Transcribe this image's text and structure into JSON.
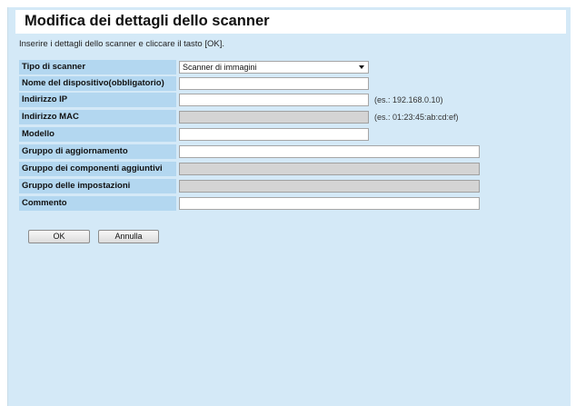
{
  "header": {
    "title": "Modifica dei dettagli dello scanner"
  },
  "instruction": "Inserire i dettagli dello scanner e cliccare il tasto [OK].",
  "form": {
    "scanner_type": {
      "label": "Tipo di scanner",
      "selected": "Scanner di immagini"
    },
    "device_name": {
      "label": "Nome del dispositivo(obbligatorio)",
      "value": ""
    },
    "ip_address": {
      "label": "Indirizzo IP",
      "value": "",
      "hint": "(es.: 192.168.0.10)"
    },
    "mac_address": {
      "label": "Indirizzo MAC",
      "value": "",
      "hint": "(es.: 01:23:45:ab:cd:ef)"
    },
    "model": {
      "label": "Modello",
      "value": ""
    },
    "update_group": {
      "label": "Gruppo di aggiornamento",
      "value": ""
    },
    "addon_group": {
      "label": "Gruppo dei componenti aggiuntivi",
      "value": ""
    },
    "settings_group": {
      "label": "Gruppo delle impostazioni",
      "value": ""
    },
    "comment": {
      "label": "Commento",
      "value": ""
    }
  },
  "buttons": {
    "ok_label": "OK",
    "cancel_label": "Annulla"
  },
  "icons": {
    "dropdown": "chevron-down-icon"
  },
  "colors": {
    "panel_background": "#d4e9f7",
    "label_background": "#b3d7f0",
    "disabled_field": "#d4d4d4"
  }
}
